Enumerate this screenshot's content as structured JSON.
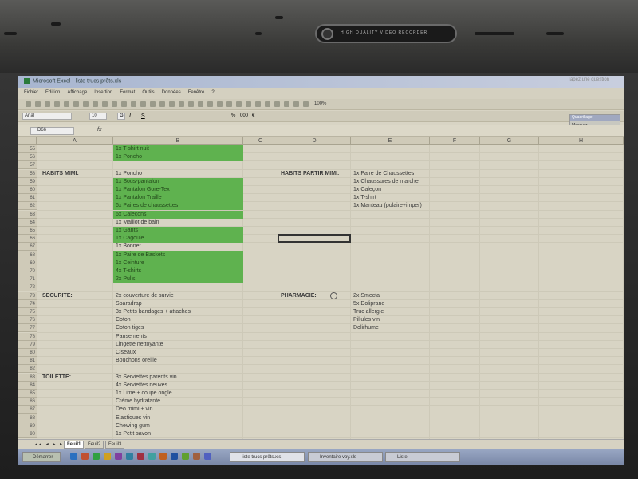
{
  "window": {
    "title": "Microsoft Excel - liste trucs prêts.xls",
    "help_placeholder": "Tapez une question"
  },
  "camera": {
    "label": "HIGH QUALITY VIDEO RECORDER"
  },
  "menu": [
    "Fichier",
    "Edition",
    "Affichage",
    "Insertion",
    "Format",
    "Outils",
    "Données",
    "Fenêtre",
    "?"
  ],
  "toolbar": {
    "zoom": "100%",
    "font_name": "Arial",
    "font_size": "10",
    "bold": "G",
    "italic": "I",
    "underline": "S",
    "percent": "%",
    "thousands": "000",
    "euro": "€"
  },
  "floating_toolbar": {
    "title": "Quadrillage",
    "item": "Masquer"
  },
  "formula_bar": {
    "name_box": "D66",
    "fx": "fx"
  },
  "columns": [
    "A",
    "B",
    "C",
    "D",
    "E",
    "F",
    "G",
    "H"
  ],
  "rows": [
    "55",
    "56",
    "57",
    "58",
    "59",
    "60",
    "61",
    "62",
    "63",
    "64",
    "65",
    "66",
    "67",
    "68",
    "69",
    "70",
    "71",
    "72",
    "73",
    "74",
    "75",
    "76",
    "77",
    "78",
    "79",
    "80",
    "81",
    "82",
    "83",
    "84",
    "85",
    "86",
    "87",
    "88",
    "89",
    "90"
  ],
  "sections": {
    "habits_mimi": "HABITS MIMI:",
    "habits_partir": "HABITS PARTIR MIMI:",
    "securite": "SECURITE:",
    "pharmacie": "PHARMACIE:",
    "toilette": "TOILETTE:"
  },
  "items_b": [
    "1x T-shirt nuit",
    "1x Poncho",
    "",
    "1x Poncho",
    "1x Sous-pantalon",
    "1x Pantalon Gore-Tex",
    "1x Pantalon Traille",
    "6x Paires de chaussettes",
    "6x Caleçons",
    "1x Maillot de bain",
    "1x Gants",
    "1x Cagoule",
    "1x Bonnet",
    "1x Paire de Baskets",
    "1x Ceinture",
    "4x T-shirts",
    "2x Pulls",
    "",
    "2x couverture de survie",
    "Sparadrap",
    "3x Petits bandages + attaches",
    "Coton",
    "Coton tiges",
    "Pansements",
    "Lingette nettoyante",
    "Ciseaux",
    "Bouchons oreille",
    "",
    "3x Serviettes parents vin",
    "4x Serviettes neuves",
    "1x Lime + coupe ongle",
    "Crème hydratante",
    "Deo mimi + vin",
    "Elastiques vin",
    "Chewing gum",
    "1x Petit savon"
  ],
  "items_e_habits": [
    "1x Paire de Chaussettes",
    "1x Chaussures de marche",
    "1x Caleçon",
    "1x T-shirt",
    "1x Manteau (polaire+imper)"
  ],
  "items_e_pharmacie": [
    "2x Smecta",
    "5x Doliprane",
    "Truc allergie",
    "Pillules vin",
    "Dolirhume"
  ],
  "sheet_tabs": [
    "Feuil1",
    "Feuil2",
    "Feuil3"
  ],
  "taskbar": {
    "start": "Démarrer",
    "buttons": [
      "liste trucs prêts.xls",
      "Inventaire voy.xls",
      "Liste"
    ]
  },
  "colors": {
    "highlight": "#5fb24f"
  }
}
